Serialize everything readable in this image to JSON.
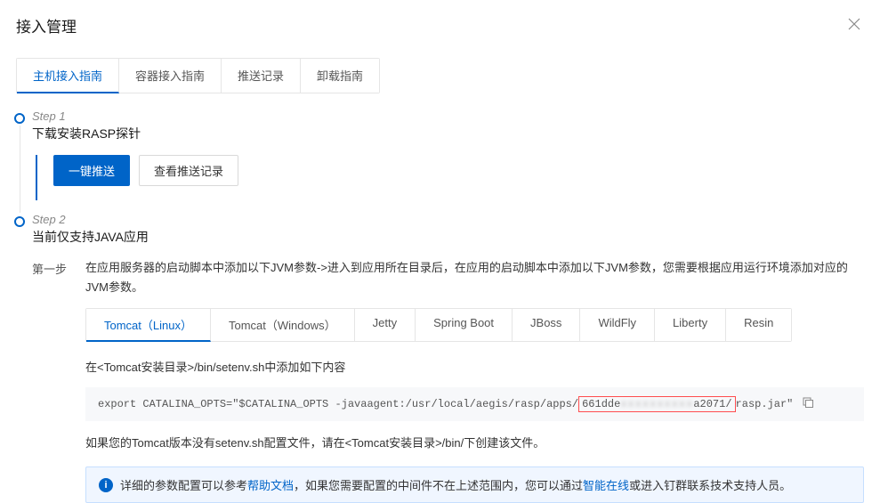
{
  "header": {
    "title": "接入管理"
  },
  "top_tabs": [
    {
      "label": "主机接入指南",
      "active": true
    },
    {
      "label": "容器接入指南",
      "active": false
    },
    {
      "label": "推送记录",
      "active": false
    },
    {
      "label": "卸载指南",
      "active": false
    }
  ],
  "step1": {
    "title": "Step 1",
    "subtitle": "下载安装RASP探针",
    "buttons": {
      "push": "一键推送",
      "view_log": "查看推送记录"
    }
  },
  "step2": {
    "title": "Step 2",
    "subtitle": "当前仅支持JAVA应用",
    "sub_label": "第一步",
    "desc": "在应用服务器的启动脚本中添加以下JVM参数->进入到应用所在目录后，在应用的启动脚本中添加以下JVM参数，您需要根据应用运行环境添加对应的JVM参数。",
    "server_tabs": [
      {
        "label": "Tomcat（Linux）",
        "active": true
      },
      {
        "label": "Tomcat（Windows）",
        "active": false
      },
      {
        "label": "Jetty",
        "active": false
      },
      {
        "label": "Spring Boot",
        "active": false
      },
      {
        "label": "JBoss",
        "active": false
      },
      {
        "label": "WildFly",
        "active": false
      },
      {
        "label": "Liberty",
        "active": false
      },
      {
        "label": "Resin",
        "active": false
      }
    ],
    "instruction": "在<Tomcat安装目录>/bin/setenv.sh中添加如下内容",
    "code": {
      "prefix": "export CATALINA_OPTS=\"$CATALINA_OPTS -javaagent:/usr/local/aegis/rasp/apps/",
      "redact_left": "661dde",
      "redact_blur": "xxxxxxxxxx",
      "redact_right": "a2071/",
      "suffix": "rasp.jar\""
    },
    "note": "如果您的Tomcat版本没有setenv.sh配置文件，请在<Tomcat安装目录>/bin/下创建该文件。",
    "banner": {
      "text_before": "详细的参数配置可以参考",
      "link1": "帮助文档",
      "text_mid": "，如果您需要配置的中间件不在上述范围内，您可以通过",
      "link2": "智能在线",
      "text_after": "或进入钉群联系技术支持人员。"
    }
  }
}
